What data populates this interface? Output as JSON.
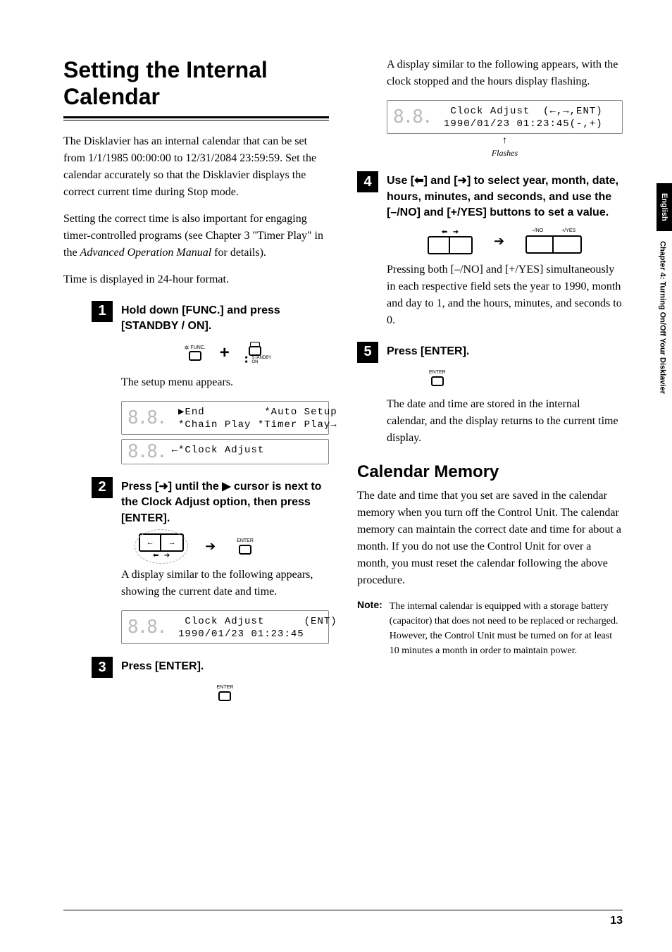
{
  "sideTab": {
    "language": "English",
    "chapter": "Chapter 4:  Turning On/Off Your Disklavier"
  },
  "title": "Setting the Internal Calendar",
  "intro1": "The Disklavier has an internal calendar that can be set from 1/1/1985 00:00:00 to 12/31/2084 23:59:59. Set the calendar accurately so that the Disklavier displays the correct current time during Stop mode.",
  "intro2_a": "Setting the correct time is also important for engaging timer-controlled programs (see Chapter 3 \"Timer Play\" in the ",
  "intro2_i": "Advanced Operation Manual",
  "intro2_b": " for details).",
  "intro3": "Time is displayed in 24-hour format.",
  "step1": {
    "num": "1",
    "text": "Hold down [FUNC.] and press [STANDBY / ON]."
  },
  "funcLabel": "FUNC.",
  "standbyLabel": "STANDBY\n/ ON",
  "plus": "+",
  "setupText": "The setup menu appears.",
  "lcd1_line1": " ▶End         *Auto Setup",
  "lcd1_line2": " *Chain Play *Timer Play→",
  "lcd2_line1": "←*Clock Adjust",
  "lcd2_line2": "",
  "step2": {
    "num": "2",
    "text_a": "Press [",
    "arrow": "➜",
    "text_b": "] until the ",
    "cursor": "▶",
    "text_c": " cursor is next to the Clock Adjust option, then press [ENTER]."
  },
  "enterLabel": "ENTER",
  "afterStep2": "A display similar to the following appears, showing the current date and time.",
  "lcd3_line1": "  Clock Adjust      (ENT)",
  "lcd3_line2": " 1990/01/23 01:23:45",
  "step3": {
    "num": "3",
    "text": "Press [ENTER]."
  },
  "col2_intro": "A display similar to the following appears, with the clock stopped and the hours display flashing.",
  "lcd4_line1": "  Clock Adjust  (←,→,ENT)",
  "lcd4_line2": " 1990/01/23 01:23:45(-,+)",
  "flashes": "Flashes",
  "step4": {
    "num": "4",
    "text_a": "Use [",
    "la": "⬅",
    "text_b": "] and [",
    "ra": "➜",
    "text_c": "] to select year, month, date, hours, minutes, and seconds, and use the [–/NO] and [+/YES] buttons to set a value."
  },
  "noLabel": "–/NO",
  "yesLabel": "+/YES",
  "afterStep4": "Pressing both [–/NO] and [+/YES] simultaneously in each respective field sets the year to 1990, month and day to 1, and the hours, minutes, and seconds to 0.",
  "step5": {
    "num": "5",
    "text": "Press [ENTER]."
  },
  "afterStep5": "The date and time are stored in the internal calendar, and the display returns to the current time display.",
  "subTitle": "Calendar Memory",
  "calMem": "The date and time that you set are saved in the calendar memory when you turn off the Control Unit. The calendar memory can maintain the correct date and time for about a month. If you do not use the Control Unit for over a month, you must reset the calendar following the above procedure.",
  "noteLabel": "Note:",
  "noteText": "The internal calendar is equipped with a storage battery (capacitor) that does not need to be replaced or recharged. However, the Control Unit must be turned on for at least 10 minutes a month in order to maintain power.",
  "pageNum": "13"
}
